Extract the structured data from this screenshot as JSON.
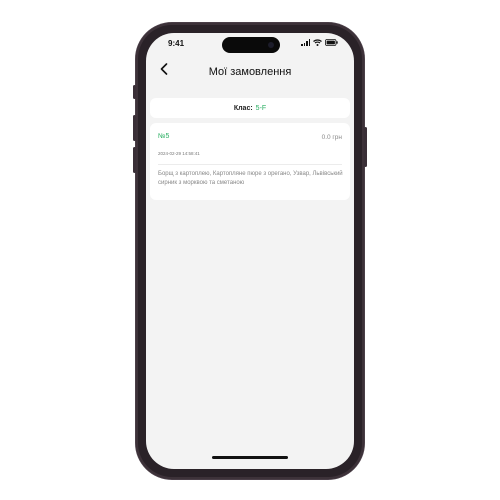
{
  "status_bar": {
    "time": "9:41"
  },
  "header": {
    "title": "Мої замовлення",
    "back_icon": "chevron-left-icon"
  },
  "class_filter": {
    "label": "Клас:",
    "value": "5-F"
  },
  "orders": [
    {
      "number": "№5",
      "price": "0.0 грн",
      "date": "2024-02-29 14:58:41",
      "items": "Борщ з картоплею, Картопляне пюре з орегано, Узвар, Львівський сирник з морквою та сметаною"
    }
  ],
  "colors": {
    "accent": "#27ae60",
    "background": "#f3f3f3",
    "card": "#ffffff"
  }
}
